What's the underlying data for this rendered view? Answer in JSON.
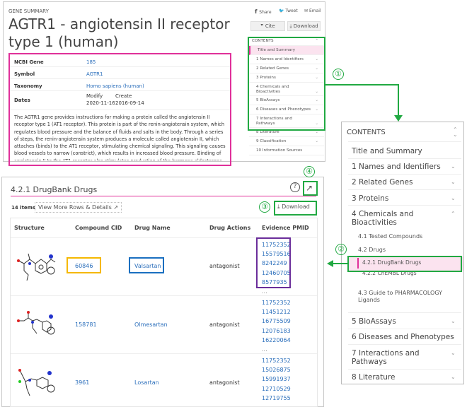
{
  "gene_summary": {
    "label": "GENE SUMMARY",
    "title": "AGTR1 - angiotensin II receptor type 1 (human)",
    "share": "Share",
    "tweet": "Tweet",
    "email": "Email",
    "cite": "Cite",
    "download": "Download",
    "info": [
      {
        "label": "NCBI Gene",
        "value": "185"
      },
      {
        "label": "Symbol",
        "value": "AGTR1"
      },
      {
        "label": "Taxonomy",
        "value": "Homo sapiens (human)"
      },
      {
        "label": "Dates",
        "modify_label": "Modify",
        "modify": "2020-11-16",
        "create_label": "Create",
        "create": "2016-09-14"
      }
    ],
    "description": "The AGTR1 gene provides instructions for making a protein called the angiotensin II receptor type 1 (AT1 receptor). This protein is part of the renin-angiotensin system, which regulates blood pressure and the balance of fluids and salts in the body. Through a series of steps, the renin-angiotensin system produces a molecule called angiotensin II, which attaches (binds) to the AT1 receptor, stimulating chemical signaling. This signaling causes blood vessels to narrow (constrict), which results in increased blood pressure. Binding of angiotensin II to the AT1 receptor also stimulates production of the hormone aldosterone, which triggers the absorption of water and salt by the",
    "contents": {
      "heading": "CONTENTS",
      "items": [
        "Title and Summary",
        "1 Names and Identifiers",
        "2 Related Genes",
        "3 Proteins",
        "4 Chemicals and Bioactivities",
        "5 BioAssays",
        "6 Diseases and Phenotypes",
        "7 Interactions and Pathways",
        "8 Literature",
        "9 Classification",
        "10 Information Sources"
      ]
    }
  },
  "drugbank": {
    "title": "4.2.1  DrugBank Drugs",
    "count": "14 items",
    "view_more": "View More Rows & Details",
    "download": "Download",
    "columns": [
      "Structure",
      "Compound CID",
      "Drug Name",
      "Drug Actions",
      "Evidence PMID"
    ],
    "rows": [
      {
        "cid": "60846",
        "name": "Valsartan",
        "action": "antagonist",
        "pmids": [
          "11752352",
          "15579516",
          "8242249",
          "12460705",
          "8577935"
        ],
        "more": "..."
      },
      {
        "cid": "158781",
        "name": "Olmesartan",
        "action": "antagonist",
        "pmids": [
          "11752352",
          "11451212",
          "16775509",
          "12076183",
          "16220064"
        ],
        "more": "..."
      },
      {
        "cid": "3961",
        "name": "Losartan",
        "action": "antagonist",
        "pmids": [
          "11752352",
          "15026875",
          "15991937",
          "12710529",
          "12719755"
        ]
      }
    ]
  },
  "contents_expanded": {
    "heading": "CONTENTS",
    "items": [
      "Title and Summary",
      "1 Names and Identifiers",
      "2 Related Genes",
      "3 Proteins",
      "4 Chemicals and Bioactivities",
      "5 BioAssays",
      "6 Diseases and Phenotypes",
      "7 Interactions and Pathways",
      "8 Literature"
    ],
    "subitems": [
      "4.1 Tested Compounds",
      "4.2 Drugs",
      "4.2.1 DrugBank Drugs",
      "4.2.2 ChEMBL Drugs",
      "4.3 Guide to PHARMACOLOGY Ligands"
    ]
  },
  "annotations": [
    "①",
    "②",
    "③",
    "④"
  ],
  "colors": {
    "green": "#21a942",
    "pink": "#e0309a",
    "orange": "#f5b800",
    "blue": "#1a6fc0",
    "purple": "#6a2d9a",
    "link": "#2a6ebb"
  }
}
